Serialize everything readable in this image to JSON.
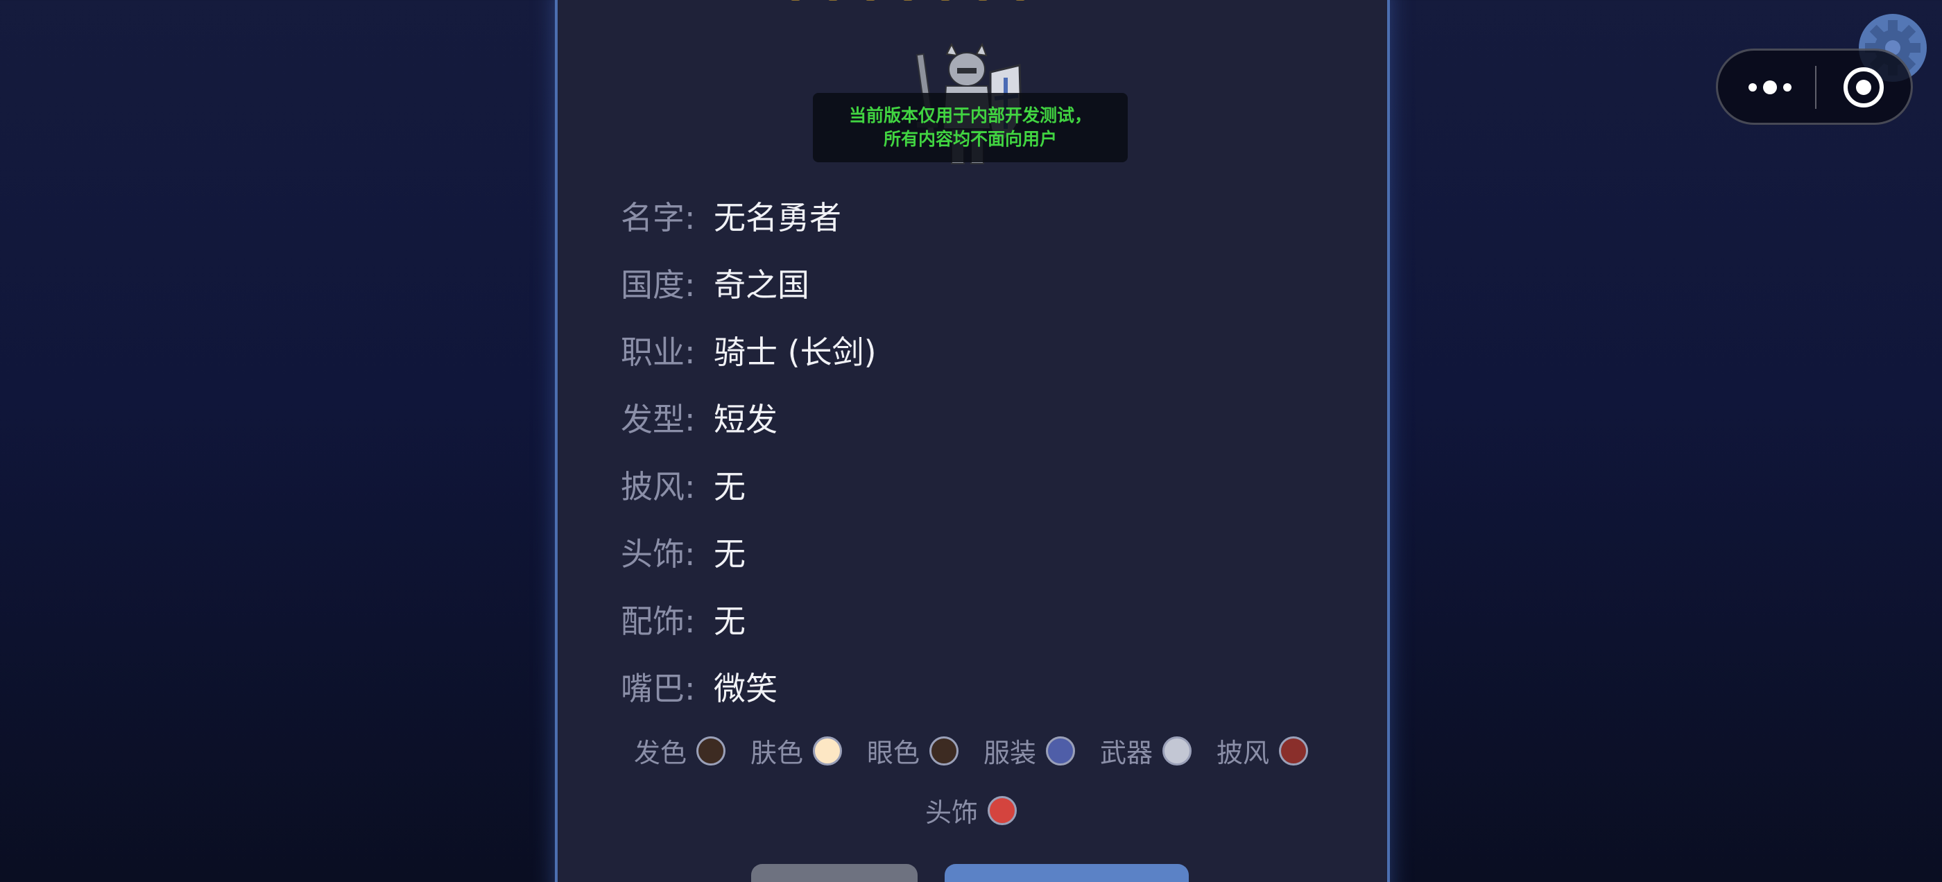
{
  "notice": {
    "line1": "当前版本仅用于内部开发测试，",
    "line2": "所有内容均不面向用户"
  },
  "character": {
    "attributes": [
      {
        "label": "名字:",
        "value": "无名勇者"
      },
      {
        "label": "国度:",
        "value": "奇之国"
      },
      {
        "label": "职业:",
        "value": "骑士 (长剑)"
      },
      {
        "label": "发型:",
        "value": "短发"
      },
      {
        "label": "披风:",
        "value": "无"
      },
      {
        "label": "头饰:",
        "value": "无"
      },
      {
        "label": "配饰:",
        "value": "无"
      },
      {
        "label": "嘴巴:",
        "value": "微笑"
      }
    ],
    "colors": [
      {
        "label": "发色",
        "color": "#3d2b22"
      },
      {
        "label": "肤色",
        "color": "#fde7c4"
      },
      {
        "label": "眼色",
        "color": "#3d2b22"
      },
      {
        "label": "服装",
        "color": "#4f5ea8"
      },
      {
        "label": "武器",
        "color": "#c3c7d4"
      },
      {
        "label": "披风",
        "color": "#8a2f2b"
      },
      {
        "label": "头饰",
        "color": "#d4443e"
      }
    ]
  },
  "icons": {
    "hero": "armored-knight-sprite",
    "more": "more-dots-icon",
    "close": "target-circle-icon",
    "settings": "gear-icon"
  },
  "theme": {
    "panel_border": "#4c6fb0",
    "notice_text": "#41d441",
    "primary_button": "#5b82c6",
    "secondary_button": "#6e7280"
  }
}
